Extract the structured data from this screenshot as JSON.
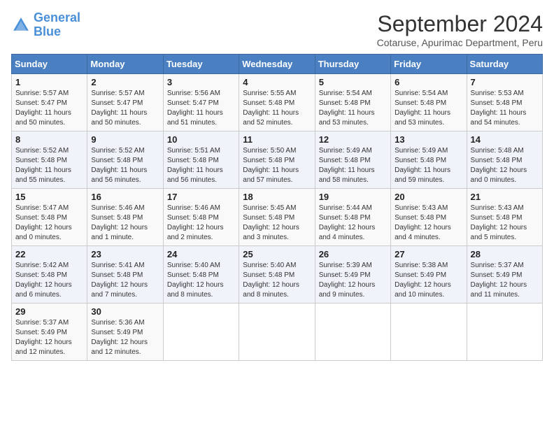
{
  "header": {
    "logo_line1": "General",
    "logo_line2": "Blue",
    "month_title": "September 2024",
    "subtitle": "Cotaruse, Apurimac Department, Peru"
  },
  "weekdays": [
    "Sunday",
    "Monday",
    "Tuesday",
    "Wednesday",
    "Thursday",
    "Friday",
    "Saturday"
  ],
  "weeks": [
    [
      {
        "day": "1",
        "sunrise": "5:57 AM",
        "sunset": "5:47 PM",
        "daylight": "11 hours and 50 minutes."
      },
      {
        "day": "2",
        "sunrise": "5:57 AM",
        "sunset": "5:47 PM",
        "daylight": "11 hours and 50 minutes."
      },
      {
        "day": "3",
        "sunrise": "5:56 AM",
        "sunset": "5:47 PM",
        "daylight": "11 hours and 51 minutes."
      },
      {
        "day": "4",
        "sunrise": "5:55 AM",
        "sunset": "5:48 PM",
        "daylight": "11 hours and 52 minutes."
      },
      {
        "day": "5",
        "sunrise": "5:54 AM",
        "sunset": "5:48 PM",
        "daylight": "11 hours and 53 minutes."
      },
      {
        "day": "6",
        "sunrise": "5:54 AM",
        "sunset": "5:48 PM",
        "daylight": "11 hours and 53 minutes."
      },
      {
        "day": "7",
        "sunrise": "5:53 AM",
        "sunset": "5:48 PM",
        "daylight": "11 hours and 54 minutes."
      }
    ],
    [
      {
        "day": "8",
        "sunrise": "5:52 AM",
        "sunset": "5:48 PM",
        "daylight": "11 hours and 55 minutes."
      },
      {
        "day": "9",
        "sunrise": "5:52 AM",
        "sunset": "5:48 PM",
        "daylight": "11 hours and 56 minutes."
      },
      {
        "day": "10",
        "sunrise": "5:51 AM",
        "sunset": "5:48 PM",
        "daylight": "11 hours and 56 minutes."
      },
      {
        "day": "11",
        "sunrise": "5:50 AM",
        "sunset": "5:48 PM",
        "daylight": "11 hours and 57 minutes."
      },
      {
        "day": "12",
        "sunrise": "5:49 AM",
        "sunset": "5:48 PM",
        "daylight": "11 hours and 58 minutes."
      },
      {
        "day": "13",
        "sunrise": "5:49 AM",
        "sunset": "5:48 PM",
        "daylight": "11 hours and 59 minutes."
      },
      {
        "day": "14",
        "sunrise": "5:48 AM",
        "sunset": "5:48 PM",
        "daylight": "12 hours and 0 minutes."
      }
    ],
    [
      {
        "day": "15",
        "sunrise": "5:47 AM",
        "sunset": "5:48 PM",
        "daylight": "12 hours and 0 minutes."
      },
      {
        "day": "16",
        "sunrise": "5:46 AM",
        "sunset": "5:48 PM",
        "daylight": "12 hours and 1 minute."
      },
      {
        "day": "17",
        "sunrise": "5:46 AM",
        "sunset": "5:48 PM",
        "daylight": "12 hours and 2 minutes."
      },
      {
        "day": "18",
        "sunrise": "5:45 AM",
        "sunset": "5:48 PM",
        "daylight": "12 hours and 3 minutes."
      },
      {
        "day": "19",
        "sunrise": "5:44 AM",
        "sunset": "5:48 PM",
        "daylight": "12 hours and 4 minutes."
      },
      {
        "day": "20",
        "sunrise": "5:43 AM",
        "sunset": "5:48 PM",
        "daylight": "12 hours and 4 minutes."
      },
      {
        "day": "21",
        "sunrise": "5:43 AM",
        "sunset": "5:48 PM",
        "daylight": "12 hours and 5 minutes."
      }
    ],
    [
      {
        "day": "22",
        "sunrise": "5:42 AM",
        "sunset": "5:48 PM",
        "daylight": "12 hours and 6 minutes."
      },
      {
        "day": "23",
        "sunrise": "5:41 AM",
        "sunset": "5:48 PM",
        "daylight": "12 hours and 7 minutes."
      },
      {
        "day": "24",
        "sunrise": "5:40 AM",
        "sunset": "5:48 PM",
        "daylight": "12 hours and 8 minutes."
      },
      {
        "day": "25",
        "sunrise": "5:40 AM",
        "sunset": "5:48 PM",
        "daylight": "12 hours and 8 minutes."
      },
      {
        "day": "26",
        "sunrise": "5:39 AM",
        "sunset": "5:49 PM",
        "daylight": "12 hours and 9 minutes."
      },
      {
        "day": "27",
        "sunrise": "5:38 AM",
        "sunset": "5:49 PM",
        "daylight": "12 hours and 10 minutes."
      },
      {
        "day": "28",
        "sunrise": "5:37 AM",
        "sunset": "5:49 PM",
        "daylight": "12 hours and 11 minutes."
      }
    ],
    [
      {
        "day": "29",
        "sunrise": "5:37 AM",
        "sunset": "5:49 PM",
        "daylight": "12 hours and 12 minutes."
      },
      {
        "day": "30",
        "sunrise": "5:36 AM",
        "sunset": "5:49 PM",
        "daylight": "12 hours and 12 minutes."
      },
      null,
      null,
      null,
      null,
      null
    ]
  ],
  "labels": {
    "sunrise": "Sunrise: ",
    "sunset": "Sunset: ",
    "daylight": "Daylight: "
  }
}
